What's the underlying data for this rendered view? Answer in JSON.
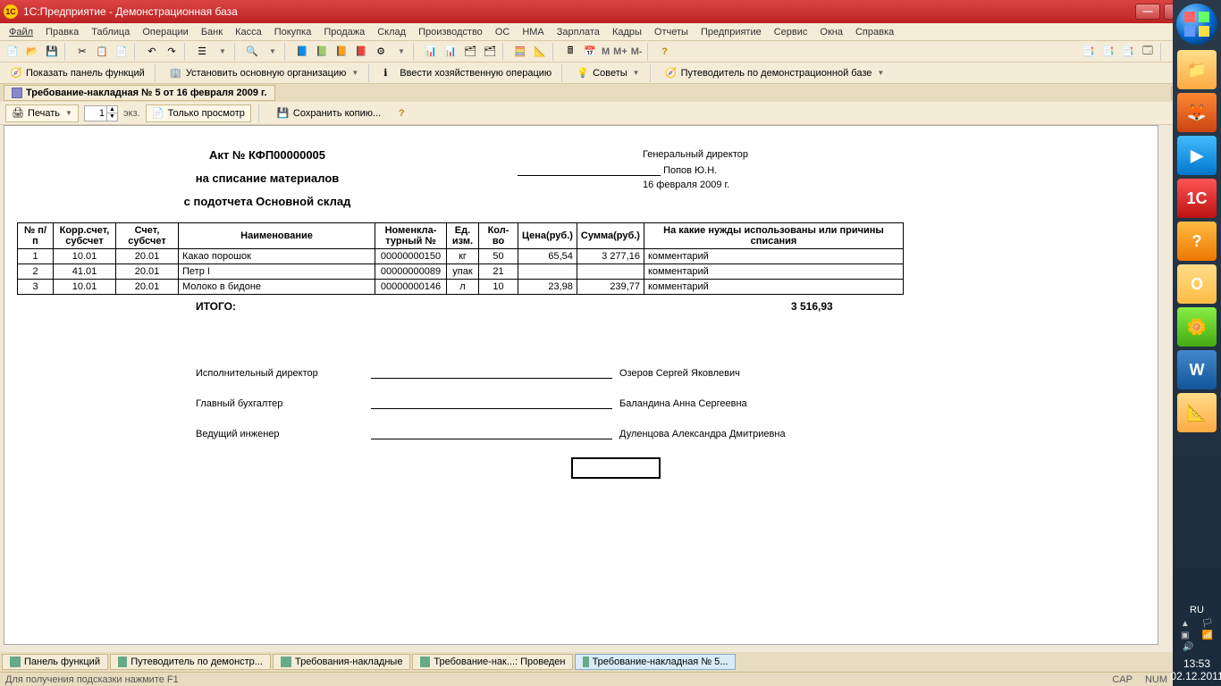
{
  "window": {
    "title": "1С:Предприятие - Демонстрационная база"
  },
  "menu": {
    "file": "Файл",
    "edit": "Правка",
    "table": "Таблица",
    "operations": "Операции",
    "bank": "Банк",
    "kassa": "Касса",
    "buy": "Покупка",
    "sell": "Продажа",
    "store": "Склад",
    "prod": "Производство",
    "os": "ОС",
    "nma": "НМА",
    "salary": "Зарплата",
    "kadry": "Кадры",
    "reports": "Отчеты",
    "company": "Предприятие",
    "service": "Сервис",
    "windows": "Окна",
    "help": "Справка"
  },
  "toolbar1": {
    "m": "M",
    "mplus": "M+",
    "mminus": "M-"
  },
  "toolbar2": {
    "show_panel": "Показать панель функций",
    "set_org": "Установить основную организацию",
    "enter_op": "Ввести хозяйственную операцию",
    "advice": "Советы",
    "guide": "Путеводитель по демонстрационной базе"
  },
  "doc_tab": {
    "title": "Требование-накладная № 5 от 16 февраля 2009 г."
  },
  "print_bar": {
    "print": "Печать",
    "copies": "1",
    "copies_lbl": "экз.",
    "preview": "Только просмотр",
    "save_copy": "Сохранить копию..."
  },
  "report": {
    "title1": "Акт № КФП00000005",
    "title2": "на списание материалов",
    "title3": "с подотчета Основной склад",
    "director_lbl": "Генеральный директор",
    "director_name": "Попов Ю.Н.",
    "date": "16 февраля 2009 г.",
    "columns": {
      "num": "№ п/п",
      "corr": "Корр.счет, субсчет",
      "acct": "Счет, субсчет",
      "name": "Наименование",
      "nomen": "Номенкла-турный №",
      "unit": "Ед. изм.",
      "qty": "Кол-во",
      "price": "Цена(руб.)",
      "sum": "Сумма(руб.)",
      "reason": "На какие нужды использованы или причины списания"
    },
    "rows": [
      {
        "n": "1",
        "corr": "10.01",
        "acct": "20.01",
        "name": "Какао порошок",
        "nom": "00000000150",
        "unit": "кг",
        "qty": "50",
        "price": "65,54",
        "sum": "3 277,16",
        "reason": "комментарий"
      },
      {
        "n": "2",
        "corr": "41.01",
        "acct": "20.01",
        "name": "Петр I",
        "nom": "00000000089",
        "unit": "упак",
        "qty": "21",
        "price": "",
        "sum": "",
        "reason": "комментарий"
      },
      {
        "n": "3",
        "corr": "10.01",
        "acct": "20.01",
        "name": "Молоко в бидоне",
        "nom": "00000000146",
        "unit": "л",
        "qty": "10",
        "price": "23,98",
        "sum": "239,77",
        "reason": "комментарий"
      }
    ],
    "total_lbl": "ИТОГО:",
    "total_val": "3 516,93",
    "signers": [
      {
        "role": "Исполнительный директор",
        "name": "Озеров Сергей Яковлевич"
      },
      {
        "role": "Главный бухгалтер",
        "name": "Баландина Анна Сергеевна"
      },
      {
        "role": "Ведущий инженер",
        "name": "Дуленцова Александра Дмитриевна"
      }
    ]
  },
  "bottom_tabs": [
    {
      "label": "Панель функций",
      "active": false
    },
    {
      "label": "Путеводитель по демонстр...",
      "active": false
    },
    {
      "label": "Требования-накладные",
      "active": false
    },
    {
      "label": "Требование-нак...: Проведен",
      "active": false
    },
    {
      "label": "Требование-накладная № 5...",
      "active": true
    }
  ],
  "status": {
    "hint": "Для получения подсказки нажмите F1",
    "cap": "CAP",
    "num": "NUM"
  },
  "system": {
    "lang": "RU",
    "time": "13:53",
    "date": "02.12.2011"
  }
}
